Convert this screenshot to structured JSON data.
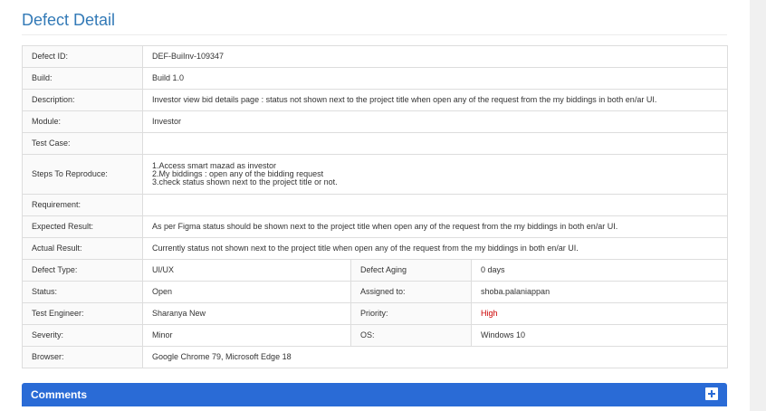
{
  "page": {
    "title": "Defect Detail"
  },
  "defect": {
    "defect_id": {
      "label": "Defect ID:",
      "value": "DEF-BuiInv-109347"
    },
    "build": {
      "label": "Build:",
      "value": "Build 1.0"
    },
    "description": {
      "label": "Description:",
      "value": "Investor view bid details page : status not shown next to the project title when open any of the request from the my biddings in both en/ar UI."
    },
    "module": {
      "label": "Module:",
      "value": "Investor"
    },
    "test_case": {
      "label": "Test Case:",
      "value": ""
    },
    "steps": {
      "label": "Steps To Reproduce:",
      "value": "1.Access smart mazad as investor\n2.My biddings : open any of the bidding request\n3.check status shown next to the project title or not."
    },
    "requirement": {
      "label": "Requirement:",
      "value": ""
    },
    "expected": {
      "label": "Expected Result:",
      "value": "As per Figma status should be shown next to the project title when open any of the request from the my biddings in both en/ar UI."
    },
    "actual": {
      "label": "Actual Result:",
      "value": "Currently status not shown next to the project title when open any of the request from the my biddings in both en/ar UI."
    },
    "defect_type": {
      "label": "Defect Type:",
      "value": "UI/UX"
    },
    "defect_aging": {
      "label": "Defect Aging",
      "value": "0 days"
    },
    "status": {
      "label": "Status:",
      "value": "Open"
    },
    "assigned_to": {
      "label": "Assigned to:",
      "value": "shoba.palaniappan"
    },
    "test_engineer": {
      "label": "Test Engineer:",
      "value": "Sharanya New"
    },
    "priority": {
      "label": "Priority:",
      "value": "High",
      "color": "#cc0000"
    },
    "severity": {
      "label": "Severity:",
      "value": "Minor"
    },
    "os": {
      "label": "OS:",
      "value": "Windows 10"
    },
    "browser": {
      "label": "Browser:",
      "value": "Google Chrome 79, Microsoft Edge 18"
    }
  },
  "comments": {
    "title": "Comments",
    "toggle_icon": "plus-icon"
  },
  "colors": {
    "accent": "#2a6bd6",
    "title": "#337ab7",
    "priority_high": "#cc0000"
  }
}
